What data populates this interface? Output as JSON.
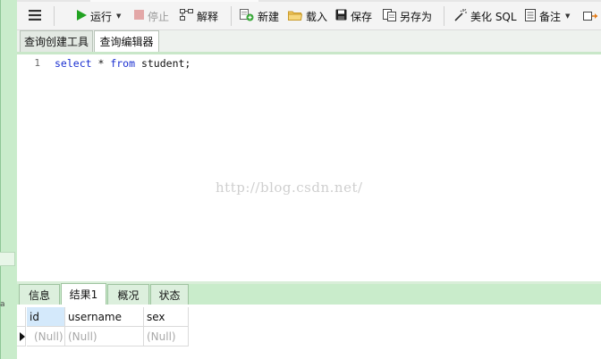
{
  "toolbar": {
    "run_label": "运行",
    "stop_label": "停止",
    "explain_label": "解释",
    "new_label": "新建",
    "load_label": "载入",
    "save_label": "保存",
    "save_as_label": "另存为",
    "beautify_label": "美化 SQL",
    "note_label": "备注"
  },
  "tabs": [
    {
      "label": "查询创建工具",
      "active": false
    },
    {
      "label": "查询编辑器",
      "active": true
    }
  ],
  "editor": {
    "line_number": "1",
    "code": {
      "kw1": "select",
      "mid": " * ",
      "kw2": "from",
      "rest": " student;"
    },
    "watermark": "http://blog.csdn.net/"
  },
  "result_tabs": [
    {
      "label": "信息",
      "active": false
    },
    {
      "label": "结果1",
      "active": true
    },
    {
      "label": "概况",
      "active": false
    },
    {
      "label": "状态",
      "active": false
    }
  ],
  "results": {
    "columns": [
      "id",
      "username",
      "sex"
    ],
    "rows": [
      [
        "(Null)",
        "(Null)",
        "(Null)"
      ]
    ]
  },
  "colors": {
    "keyword": "#1a2fd0",
    "accent_green": "#c9eccb",
    "selected_header": "#d4e9fb"
  }
}
